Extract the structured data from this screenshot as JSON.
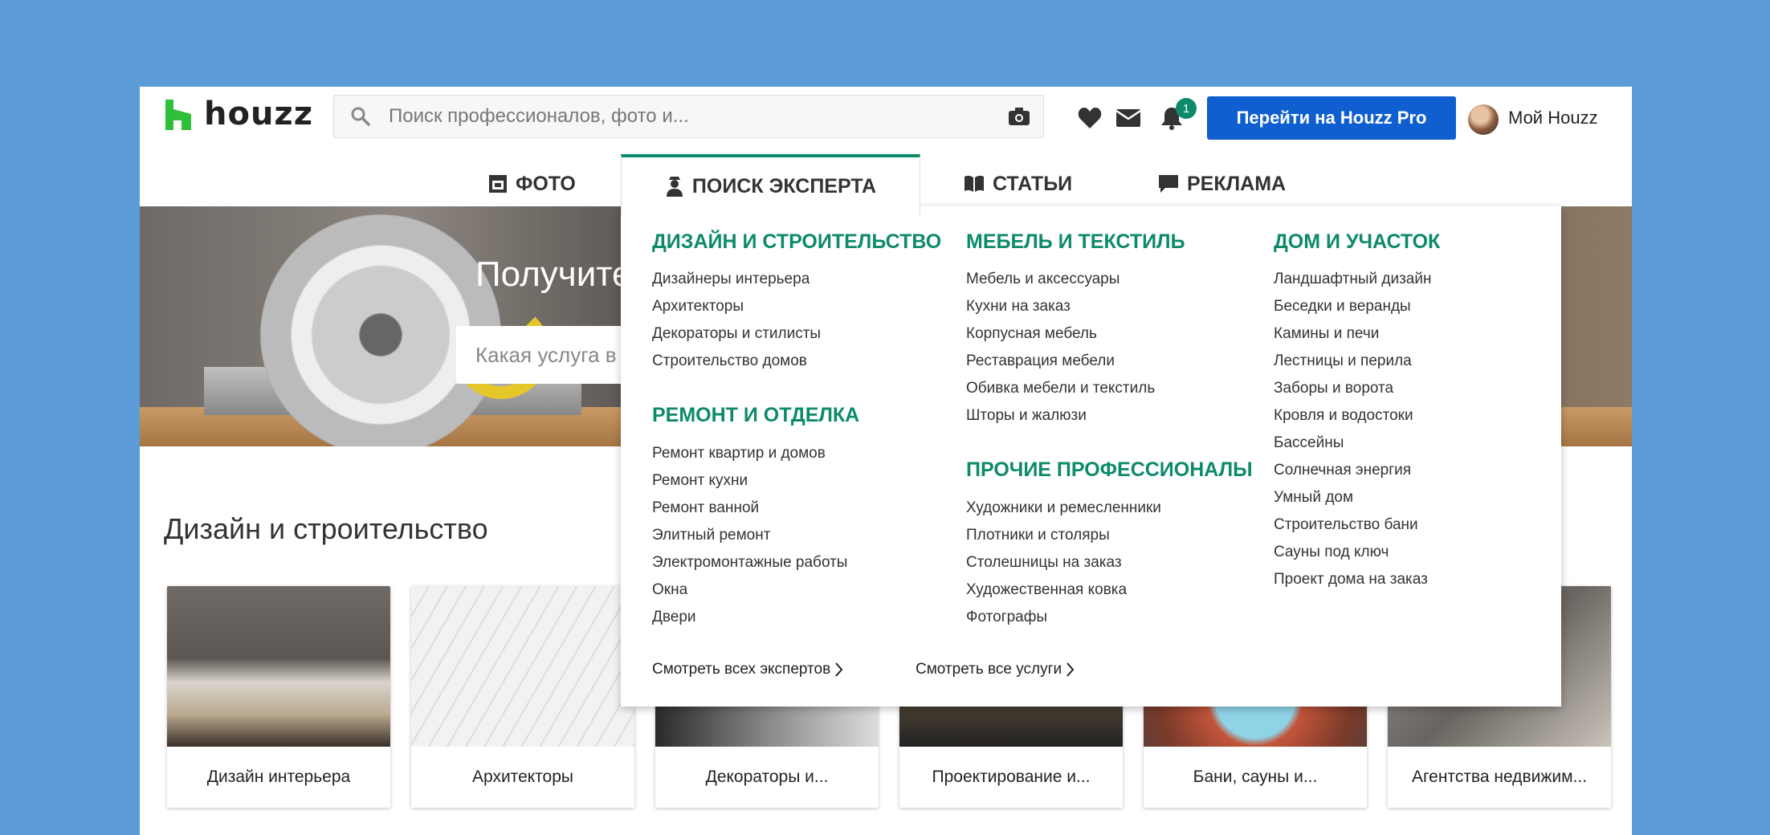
{
  "header": {
    "logo_text": "houzz",
    "search_placeholder": "Поиск профессионалов, фото и...",
    "notification_count": "1",
    "pro_button": "Перейти на Houzz Pro",
    "my_houzz": "Мой Houzz"
  },
  "nav": {
    "tabs": [
      {
        "label": "ФОТО",
        "icon": "photo-icon"
      },
      {
        "label": "ПОИСК ЭКСПЕРТА",
        "icon": "expert-icon"
      },
      {
        "label": "СТАТЬИ",
        "icon": "book-icon"
      },
      {
        "label": "РЕКЛАМА",
        "icon": "chat-icon"
      }
    ]
  },
  "hero": {
    "title": "Получите",
    "input_placeholder": "Какая услуга в"
  },
  "section": {
    "title": "Дизайн и строительство",
    "cards": [
      {
        "label": "Дизайн интерьера"
      },
      {
        "label": "Архитекторы"
      },
      {
        "label": "Декораторы и..."
      },
      {
        "label": "Проектирование и..."
      },
      {
        "label": "Бани, сауны и..."
      },
      {
        "label": "Агентства недвижим..."
      }
    ]
  },
  "dropdown": {
    "col1": {
      "head1": "ДИЗАЙН И СТРОИТЕЛЬСТВО",
      "items1": [
        "Дизайнеры интерьера",
        "Архитекторы",
        "Декораторы и стилисты",
        "Строительство домов"
      ],
      "head2": "РЕМОНТ И ОТДЕЛКА",
      "items2": [
        "Ремонт квартир и домов",
        "Ремонт кухни",
        "Ремонт ванной",
        "Элитный ремонт",
        "Электромонтажные работы",
        "Окна",
        "Двери"
      ]
    },
    "col2": {
      "head1": "МЕБЕЛЬ И ТЕКСТИЛЬ",
      "items1": [
        "Мебель и аксессуары",
        "Кухни на заказ",
        "Корпусная мебель",
        "Реставрация мебели",
        "Обивка мебели и текстиль",
        "Шторы и жалюзи"
      ],
      "head2": "ПРОЧИЕ ПРОФЕССИОНАЛЫ",
      "items2": [
        "Художники и ремесленники",
        "Плотники и столяры",
        "Столешницы на заказ",
        "Художественная ковка",
        "Фотографы"
      ]
    },
    "col3": {
      "head1": "ДОМ И УЧАСТОК",
      "items1": [
        "Ландшафтный дизайн",
        "Беседки и веранды",
        "Камины и печи",
        "Лестницы и перила",
        "Заборы и ворота",
        "Кровля и водостоки",
        "Бассейны",
        "Солнечная энергия",
        "Умный дом",
        "Строительство бани",
        "Сауны под ключ",
        "Проект дома на заказ"
      ]
    },
    "see_all_experts": "Смотреть всех экспертов",
    "see_all_services": "Смотреть все услуги"
  },
  "colors": {
    "accent_green": "#0d8a6a",
    "pro_blue": "#0f5fd1",
    "page_background": "#5a9bd8"
  }
}
